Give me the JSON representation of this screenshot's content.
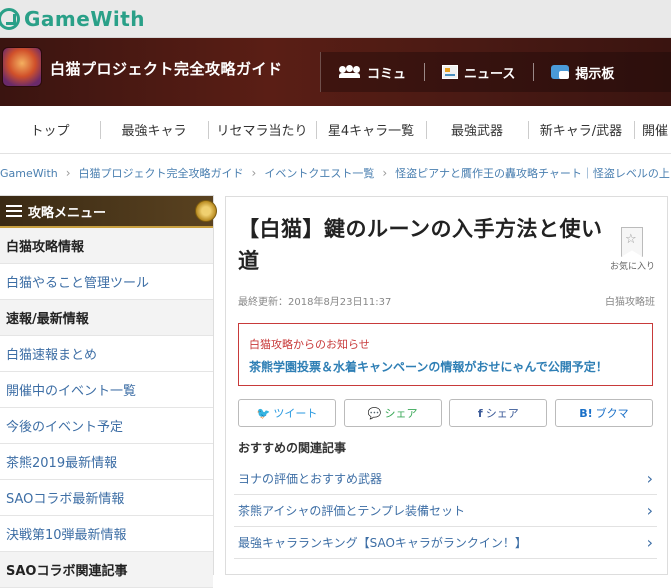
{
  "site": {
    "logo_text": "GameWith"
  },
  "banner": {
    "game_title": "白猫プロジェクト完全攻略ガイド",
    "nav": [
      {
        "label": "コミュ",
        "icon": "community-icon"
      },
      {
        "label": "ニュース",
        "icon": "news-icon"
      },
      {
        "label": "掲示板",
        "icon": "bbs-icon"
      }
    ]
  },
  "main_nav": [
    "トップ",
    "最強キャラ",
    "リセマラ当たり",
    "星4キャラ一覧",
    "最強武器",
    "新キャラ/武器",
    "開催"
  ],
  "breadcrumb": [
    "GameWith",
    "白猫プロジェクト完全攻略ガイド",
    "イベントクエスト一覧",
    "怪盗ピアナと贋作王の轟攻略チャート｜怪盗レベルの上げ"
  ],
  "sidebar": {
    "header": "攻略メニュー",
    "items": [
      {
        "label": "白猫攻略情報",
        "type": "category"
      },
      {
        "label": "白猫やること管理ツール",
        "type": "link"
      },
      {
        "label": "速報/最新情報",
        "type": "category"
      },
      {
        "label": "白猫速報まとめ",
        "type": "link"
      },
      {
        "label": "開催中のイベント一覧",
        "type": "link"
      },
      {
        "label": "今後のイベント予定",
        "type": "link"
      },
      {
        "label": "茶熊2019最新情報",
        "type": "link"
      },
      {
        "label": "SAOコラボ最新情報",
        "type": "link"
      },
      {
        "label": "決戦第10弾最新情報",
        "type": "link"
      },
      {
        "label": "SAOコラボ関連記事",
        "type": "category"
      }
    ]
  },
  "article": {
    "title": "【白猫】鍵のルーンの入手方法と使い道",
    "favorite_label": "お気に入り",
    "updated": "最終更新：2018年8月23日11:37",
    "author": "白猫攻略班",
    "notice": {
      "title": "白猫攻略からのお知らせ",
      "text": "茶熊学園投票＆水着キャンペーンの情報がおせにゃんで公開予定！"
    },
    "share": [
      {
        "label": "ツイート",
        "icon": "twitter-icon"
      },
      {
        "label": "シェア",
        "icon": "line-icon"
      },
      {
        "label": "シェア",
        "icon": "facebook-icon"
      },
      {
        "label": "ブクマ",
        "icon": "hatena-bookmark-icon",
        "prefix": "B!"
      }
    ],
    "related_title": "おすすめの関連記事",
    "related": [
      "ヨナの評価とおすすめ武器",
      "茶熊アイシャの評価とテンプレ装備セット",
      "最強キャラランキング【SAOキャラがランクイン！】"
    ]
  }
}
